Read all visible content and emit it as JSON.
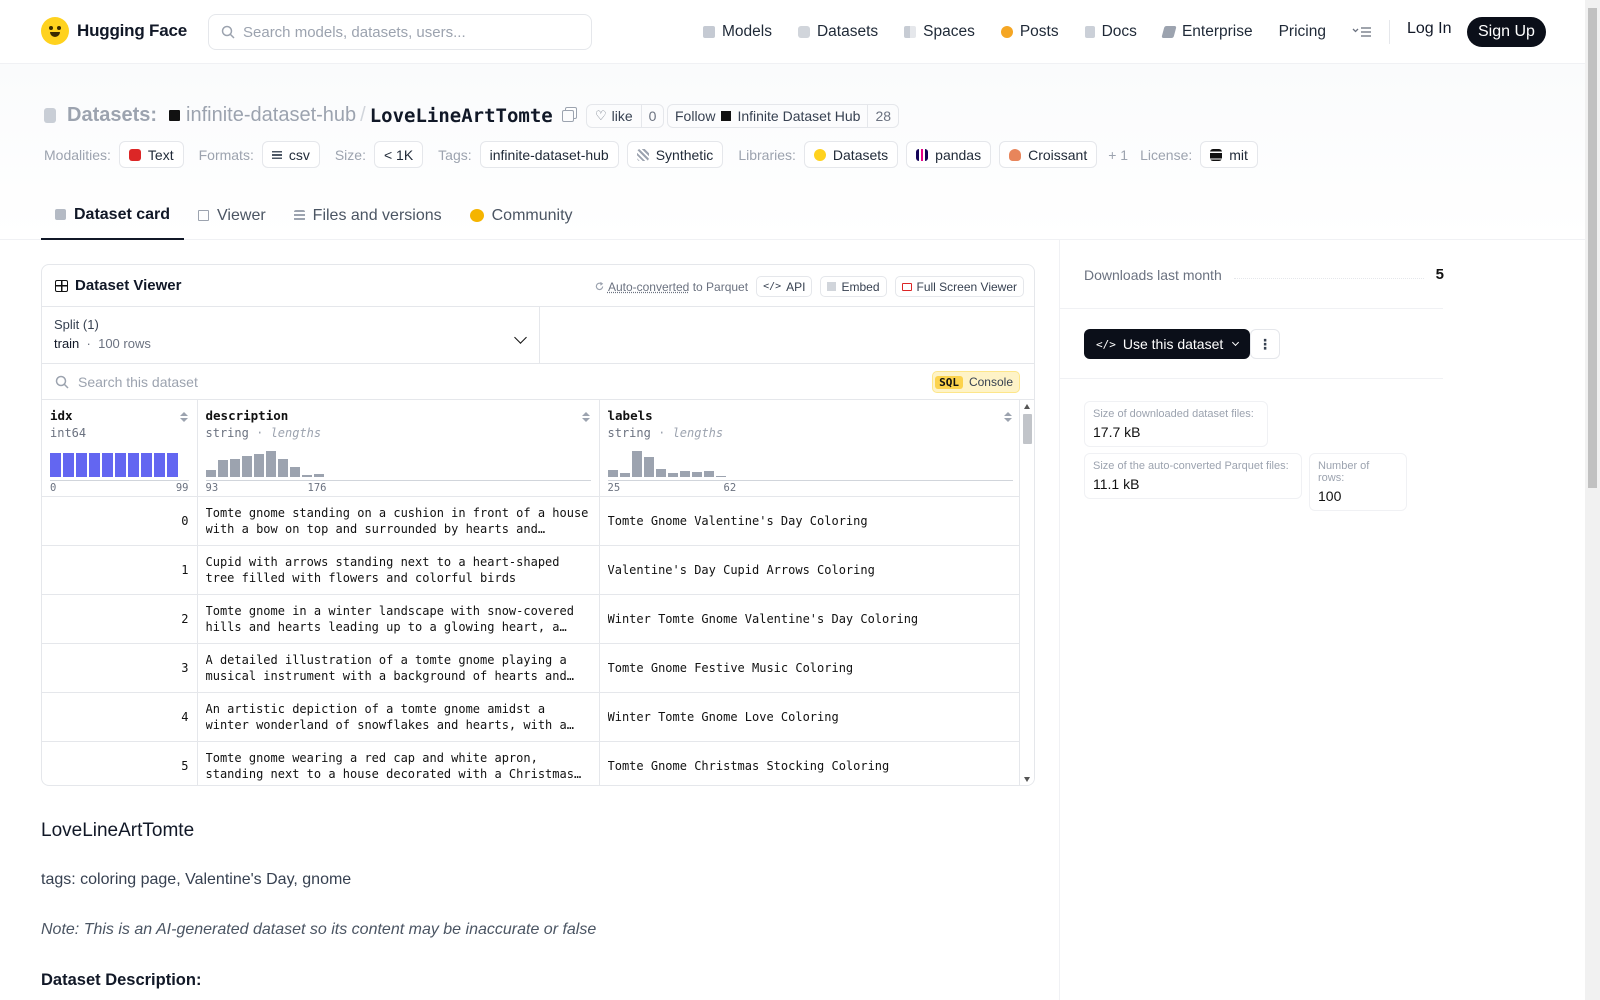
{
  "nav": {
    "brand": "Hugging Face",
    "search_placeholder": "Search models, datasets, users...",
    "links": [
      "Models",
      "Datasets",
      "Spaces",
      "Posts",
      "Docs",
      "Enterprise",
      "Pricing"
    ],
    "login": "Log In",
    "signup": "Sign Up"
  },
  "repo": {
    "type_label": "Datasets:",
    "org": "infinite-dataset-hub",
    "name": "LoveLineArtTomte",
    "like_label": "like",
    "like_count": "0",
    "follow_label": "Follow",
    "follow_org": "Infinite Dataset Hub",
    "follow_count": "28"
  },
  "meta": {
    "modalities_label": "Modalities:",
    "modalities": [
      "Text"
    ],
    "formats_label": "Formats:",
    "formats": [
      "csv"
    ],
    "size_label": "Size:",
    "size": "< 1K",
    "tags_label": "Tags:",
    "tags": [
      "infinite-dataset-hub",
      "Synthetic"
    ],
    "libraries_label": "Libraries:",
    "libraries": [
      "Datasets",
      "pandas",
      "Croissant"
    ],
    "libraries_more": "+ 1",
    "license_label": "License:",
    "license": "mit"
  },
  "tabs": [
    "Dataset card",
    "Viewer",
    "Files and versions",
    "Community"
  ],
  "viewer": {
    "title": "Dataset Viewer",
    "auto_converted": "Auto-converted",
    "to_parquet": "to Parquet",
    "api": "API",
    "embed": "Embed",
    "fullscreen": "Full Screen Viewer",
    "split_label": "Split (1)",
    "split_value": "train",
    "split_rows": "100 rows",
    "search_placeholder": "Search this dataset",
    "sql_tag": "SQL",
    "sql_label": "Console",
    "columns": [
      {
        "name": "idx",
        "type": "int64",
        "lengths": "",
        "min": "0",
        "max": "99"
      },
      {
        "name": "description",
        "type": "string",
        "lengths": "lengths",
        "min": "93",
        "max": "176"
      },
      {
        "name": "labels",
        "type": "string",
        "lengths": "lengths",
        "min": "25",
        "max": "62"
      }
    ],
    "hist_desc": [
      0.25,
      0.65,
      0.7,
      0.8,
      0.9,
      1.0,
      0.7,
      0.4,
      0.06,
      0.12
    ],
    "hist_labels": [
      0.25,
      0.15,
      1.0,
      0.75,
      0.3,
      0.15,
      0.22,
      0.2,
      0.22,
      0.04
    ],
    "rows": [
      {
        "idx": "0",
        "description": "Tomte gnome standing on a cushion in front of a house with a bow on top and surrounded by hearts and flowers",
        "labels": "Tomte Gnome Valentine's Day Coloring"
      },
      {
        "idx": "1",
        "description": "Cupid with arrows standing next to a heart-shaped tree filled with flowers and colorful birds",
        "labels": "Valentine's Day Cupid Arrows Coloring"
      },
      {
        "idx": "2",
        "description": "Tomte gnome in a winter landscape with snow-covered hills and hearts leading up to a glowing heart, a clear night sky",
        "labels": "Winter Tomte Gnome Valentine's Day Coloring"
      },
      {
        "idx": "3",
        "description": "A detailed illustration of a tomte gnome playing a musical instrument with a background of hearts and musical notes",
        "labels": "Tomte Gnome Festive Music Coloring"
      },
      {
        "idx": "4",
        "description": "An artistic depiction of a tomte gnome amidst a winter wonderland of snowflakes and hearts, with a small cottage",
        "labels": "Winter Tomte Gnome Love Coloring"
      },
      {
        "idx": "5",
        "description": "Tomte gnome wearing a red cap and white apron, standing next to a house decorated with a Christmas tree and lights",
        "labels": "Tomte Gnome Christmas Stocking Coloring"
      }
    ]
  },
  "card": {
    "title": "LoveLineArtTomte",
    "tags_line": "tags: coloring page, Valentine's Day, gnome",
    "note": "Note: This is an AI-generated dataset so its content may be inaccurate or false",
    "section": "Dataset Description:"
  },
  "sidebar": {
    "downloads_label": "Downloads last month",
    "downloads": "5",
    "use_button": "Use this dataset",
    "more": "⋮",
    "stats": [
      {
        "label": "Size of downloaded dataset files:",
        "value": "17.7 kB"
      },
      {
        "label": "Size of the auto-converted Parquet files:",
        "value": "11.1 kB"
      },
      {
        "label": "Number of rows:",
        "value": "100"
      }
    ]
  }
}
